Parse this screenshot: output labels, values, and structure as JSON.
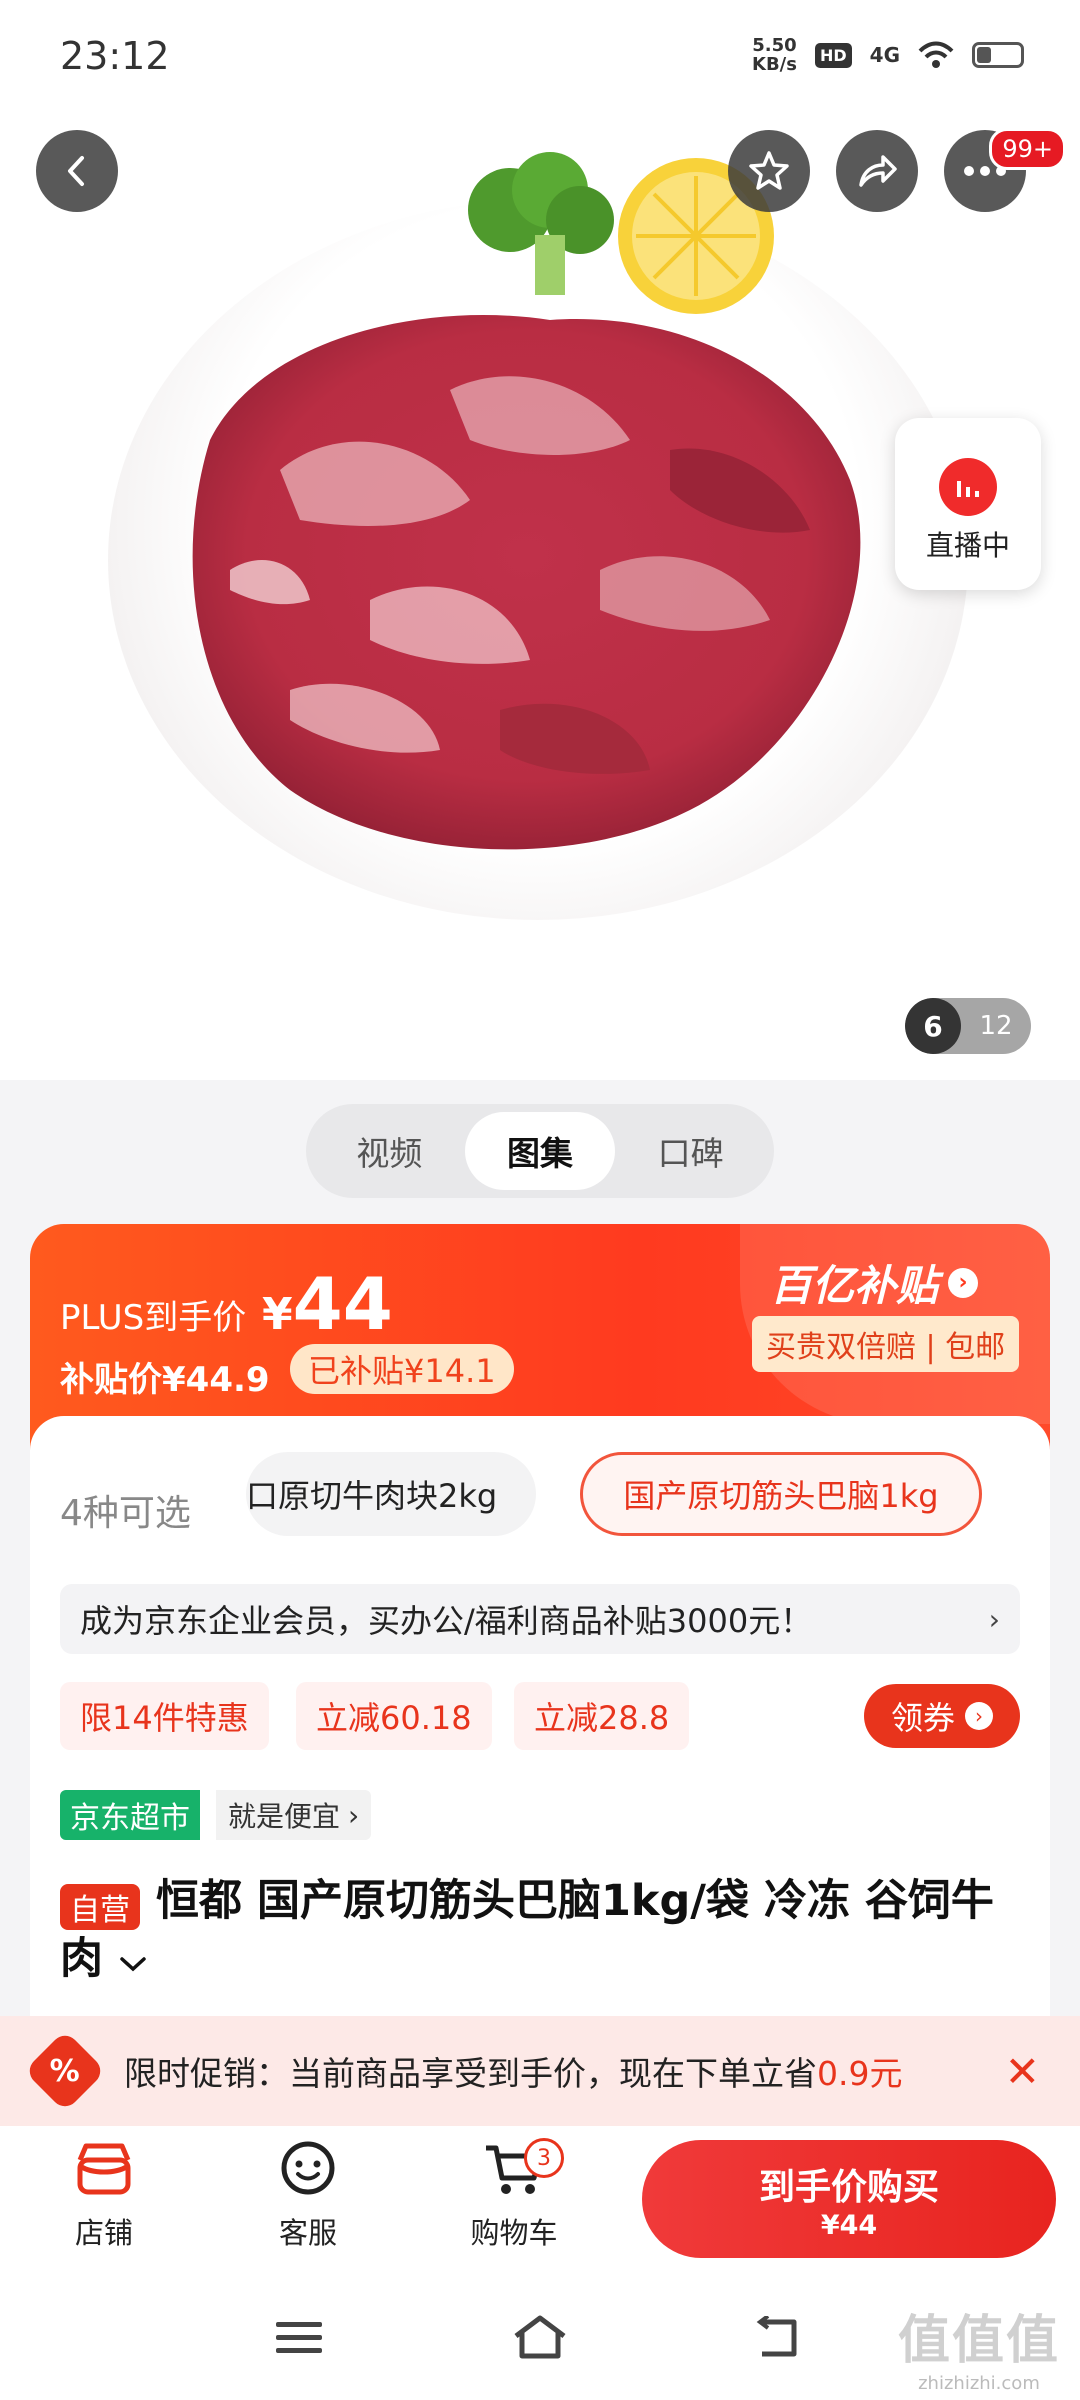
{
  "status_bar": {
    "time": "23:12",
    "net_speed_value": "5.50",
    "net_speed_unit": "KB/s",
    "hd": "HD",
    "network": "4G"
  },
  "hero": {
    "badge": "99+",
    "live_label": "直播中",
    "pager_current": "6",
    "pager_total": "12"
  },
  "media_tabs": [
    "视频",
    "图集",
    "口碑"
  ],
  "price": {
    "plus_label": "PLUS到手价",
    "currency": "¥",
    "plus_value": "44",
    "subsidy_price": "补贴价¥44.9",
    "subsidy_tag": "已补贴¥14.1",
    "brand": "百亿补贴",
    "guarantee": "买贵双倍赔 | 包邮"
  },
  "variants": {
    "count_label": "4种可选",
    "options": [
      "口原切牛肉块2kg",
      "国产原切筋头巴脑1kg"
    ]
  },
  "enterprise_banner": "成为京东企业会员，买办公/福利商品补贴3000元！",
  "promos": [
    "限14件特惠",
    "立减60.18",
    "立减28.8"
  ],
  "coupon_label": "领券",
  "store_tag": {
    "name": "京东超市",
    "slogan": "就是便宜"
  },
  "product": {
    "self_tag": "自营",
    "title": "恒都 国产原切筋头巴脑1kg/袋 冷冻 谷饲牛肉"
  },
  "flash_promo": {
    "text": "限时促销：当前商品享受到手价，现在下单立省",
    "amount": "0.9元"
  },
  "bottom_nav": {
    "store": "店铺",
    "service": "客服",
    "cart": "购物车",
    "cart_count": "3",
    "buy_label": "到手价购买",
    "buy_price": "¥44"
  },
  "watermark": {
    "brand": "值值值",
    "site": "zhizhizhi.com"
  },
  "colors": {
    "accent": "#E8341C",
    "price_banner": "#FF4A1F",
    "jd_green": "#17B26A"
  }
}
